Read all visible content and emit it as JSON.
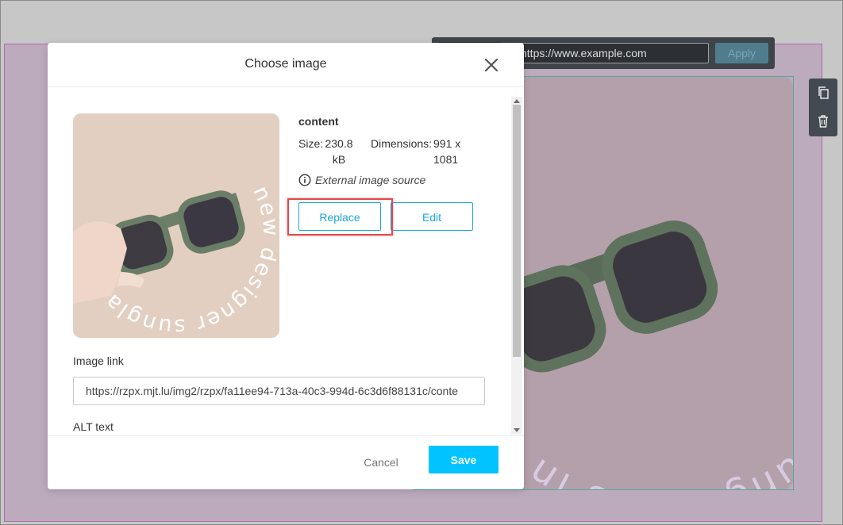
{
  "toolbar": {
    "url_value": "https://www.example.com",
    "apply_label": "Apply"
  },
  "background_image": {
    "circular_text": "new designer sunglasses in s"
  },
  "modal": {
    "title": "Choose image",
    "image": {
      "name": "content",
      "size_label": "Size:",
      "size_value": "230.8 kB",
      "dimensions_label": "Dimensions:",
      "dimensions_value": "991 x 1081",
      "source_note": "External image source",
      "circular_text": "new designer sunglasses in s"
    },
    "replace_label": "Replace",
    "edit_label": "Edit",
    "image_link_label": "Image link",
    "image_link_value": "https://rzpx.mjt.lu/img2/rzpx/fa11ee94-713a-40c3-994d-6c3d6f88131c/conte",
    "alt_text_label": "ALT text",
    "cancel_label": "Cancel",
    "save_label": "Save"
  },
  "colors": {
    "accent": "#00c3ff",
    "link_blue": "#1aa7de",
    "highlight_red": "#e2484b",
    "section_border": "#b267b0"
  }
}
